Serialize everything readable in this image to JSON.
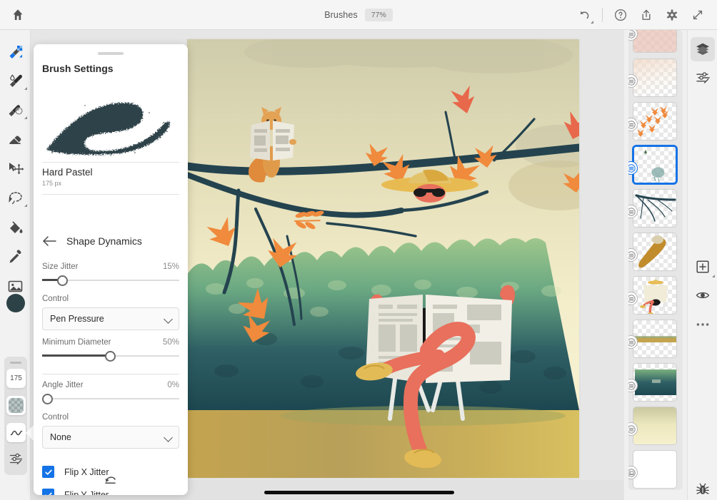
{
  "topbar": {
    "home_icon": "home-icon",
    "title": "Brushes",
    "zoom": "77%",
    "actions": [
      {
        "name": "undo-button",
        "icon": "undo-icon"
      },
      {
        "name": "help-button",
        "icon": "help-circle-icon"
      },
      {
        "name": "share-button",
        "icon": "share-export-icon"
      },
      {
        "name": "settings-button",
        "icon": "gear-icon"
      },
      {
        "name": "fullscreen-button",
        "icon": "expand-diagonal-icon"
      }
    ]
  },
  "left_toolbar": {
    "tools": [
      {
        "name": "tool-paint-brush",
        "icon": "paint-brush-icon",
        "active": true,
        "has_flyout": false
      },
      {
        "name": "tool-blend-brush",
        "icon": "water-drop-brush-icon",
        "active": false,
        "has_flyout": true
      },
      {
        "name": "tool-smudge-brush",
        "icon": "smudge-brush-icon",
        "active": false,
        "has_flyout": true
      },
      {
        "name": "tool-eraser",
        "icon": "eraser-icon",
        "active": false,
        "has_flyout": false
      },
      {
        "name": "tool-transform",
        "icon": "move-transform-icon",
        "active": false,
        "has_flyout": false
      },
      {
        "name": "tool-lasso-select",
        "icon": "lasso-select-icon",
        "active": false,
        "has_flyout": true
      },
      {
        "name": "tool-fill",
        "icon": "paint-bucket-icon",
        "active": false,
        "has_flyout": false
      },
      {
        "name": "tool-eyedropper",
        "icon": "eyedropper-icon",
        "active": false,
        "has_flyout": false
      },
      {
        "name": "tool-place-image",
        "icon": "image-icon",
        "active": false,
        "has_flyout": false
      }
    ],
    "color_swatch": "#2d4246",
    "brush_size_value": "175",
    "opacity_icon": "checker-square-icon",
    "smoothing_icon": "wave-icon",
    "brush_settings_icon": "sliders-icon"
  },
  "brush_panel": {
    "title": "Brush Settings",
    "preview_icon": "brush-stroke-preview",
    "brush_name": "Hard Pastel",
    "brush_size": "175 px",
    "back_icon": "arrow-left-icon",
    "section": "Shape Dynamics",
    "sliders": [
      {
        "name": "size-jitter-slider",
        "label": "Size Jitter",
        "value": "15%",
        "percent": 15
      },
      {
        "name": "minimum-diameter-slider",
        "label": "Minimum Diameter",
        "value": "50%",
        "percent": 50
      },
      {
        "name": "angle-jitter-slider",
        "label": "Angle Jitter",
        "value": "0%",
        "percent": 0
      }
    ],
    "controls": [
      {
        "name": "size-jitter-control-select",
        "label": "Control",
        "value": "Pen Pressure"
      },
      {
        "name": "angle-jitter-control-select",
        "label": "Control",
        "value": "None"
      }
    ],
    "checkboxes": [
      {
        "name": "flip-x-jitter-checkbox",
        "label": "Flip X Jitter",
        "checked": true
      },
      {
        "name": "flip-y-jitter-checkbox",
        "label": "Flip Y Jitter",
        "checked": true
      }
    ],
    "reset_icon": "reset-icon",
    "accent_color": "#1473e6"
  },
  "layers": {
    "items": [
      {
        "name": "layer-thumbnail-1",
        "badge": "layers-blend-icon",
        "selected": false,
        "content": "pink-wash"
      },
      {
        "name": "layer-thumbnail-2",
        "badge": "layers-blend-icon",
        "selected": false,
        "content": "warm-gradient"
      },
      {
        "name": "layer-thumbnail-3",
        "badge": "layers-blend-icon",
        "selected": false,
        "content": "orange-leaves"
      },
      {
        "name": "layer-thumbnail-4",
        "badge": "layers-blend-icon",
        "selected": true,
        "content": "teal-bush-sketch"
      },
      {
        "name": "layer-thumbnail-5",
        "badge": "layers-blend-icon",
        "selected": false,
        "content": "dark-branch"
      },
      {
        "name": "layer-thumbnail-6",
        "badge": "layers-blend-icon",
        "selected": false,
        "content": "squirrel-tail"
      },
      {
        "name": "layer-thumbnail-7",
        "badge": "layers-blend-icon",
        "selected": false,
        "content": "person-reading"
      },
      {
        "name": "layer-thumbnail-8",
        "badge": "layers-blend-icon",
        "selected": false,
        "content": "ground-strip"
      },
      {
        "name": "layer-thumbnail-9",
        "badge": "layers-blend-icon",
        "selected": false,
        "content": "green-hedge"
      },
      {
        "name": "layer-thumbnail-10",
        "badge": "layers-blend-icon",
        "selected": false,
        "content": "sky-wash"
      },
      {
        "name": "layer-background",
        "badge": "image-icon",
        "selected": false,
        "content": "white-background"
      }
    ]
  },
  "right_rail": {
    "buttons": [
      {
        "name": "layers-panel-button",
        "icon": "layers-icon",
        "active": true,
        "has_flyout": false
      },
      {
        "name": "adjustments-panel-button",
        "icon": "sliders-icon",
        "active": false,
        "has_flyout": false
      },
      {
        "name": "add-layer-button",
        "icon": "plus-square-icon",
        "active": false,
        "has_flyout": true
      },
      {
        "name": "layer-visibility-button",
        "icon": "eye-icon",
        "active": false,
        "has_flyout": false
      },
      {
        "name": "more-options-button",
        "icon": "ellipsis-icon",
        "active": false,
        "has_flyout": false
      },
      {
        "name": "feedback-bug-button",
        "icon": "bug-icon",
        "active": false,
        "has_flyout": false
      }
    ]
  },
  "canvas": {
    "artwork_title": "person-reading-newspaper-illustration",
    "palette": {
      "sky_top": "#c9c7a8",
      "sky_bottom": "#f3ecc8",
      "hedge_light": "#8fbf86",
      "hedge_dark": "#1f4b52",
      "ground": "#c8a646",
      "branch": "#24434f",
      "leaf_orange": "#f08a3c",
      "leaf_red": "#e8684c",
      "newspaper": "#ede8de",
      "skin": "#e8705c",
      "hat": "#e8bb52"
    }
  }
}
